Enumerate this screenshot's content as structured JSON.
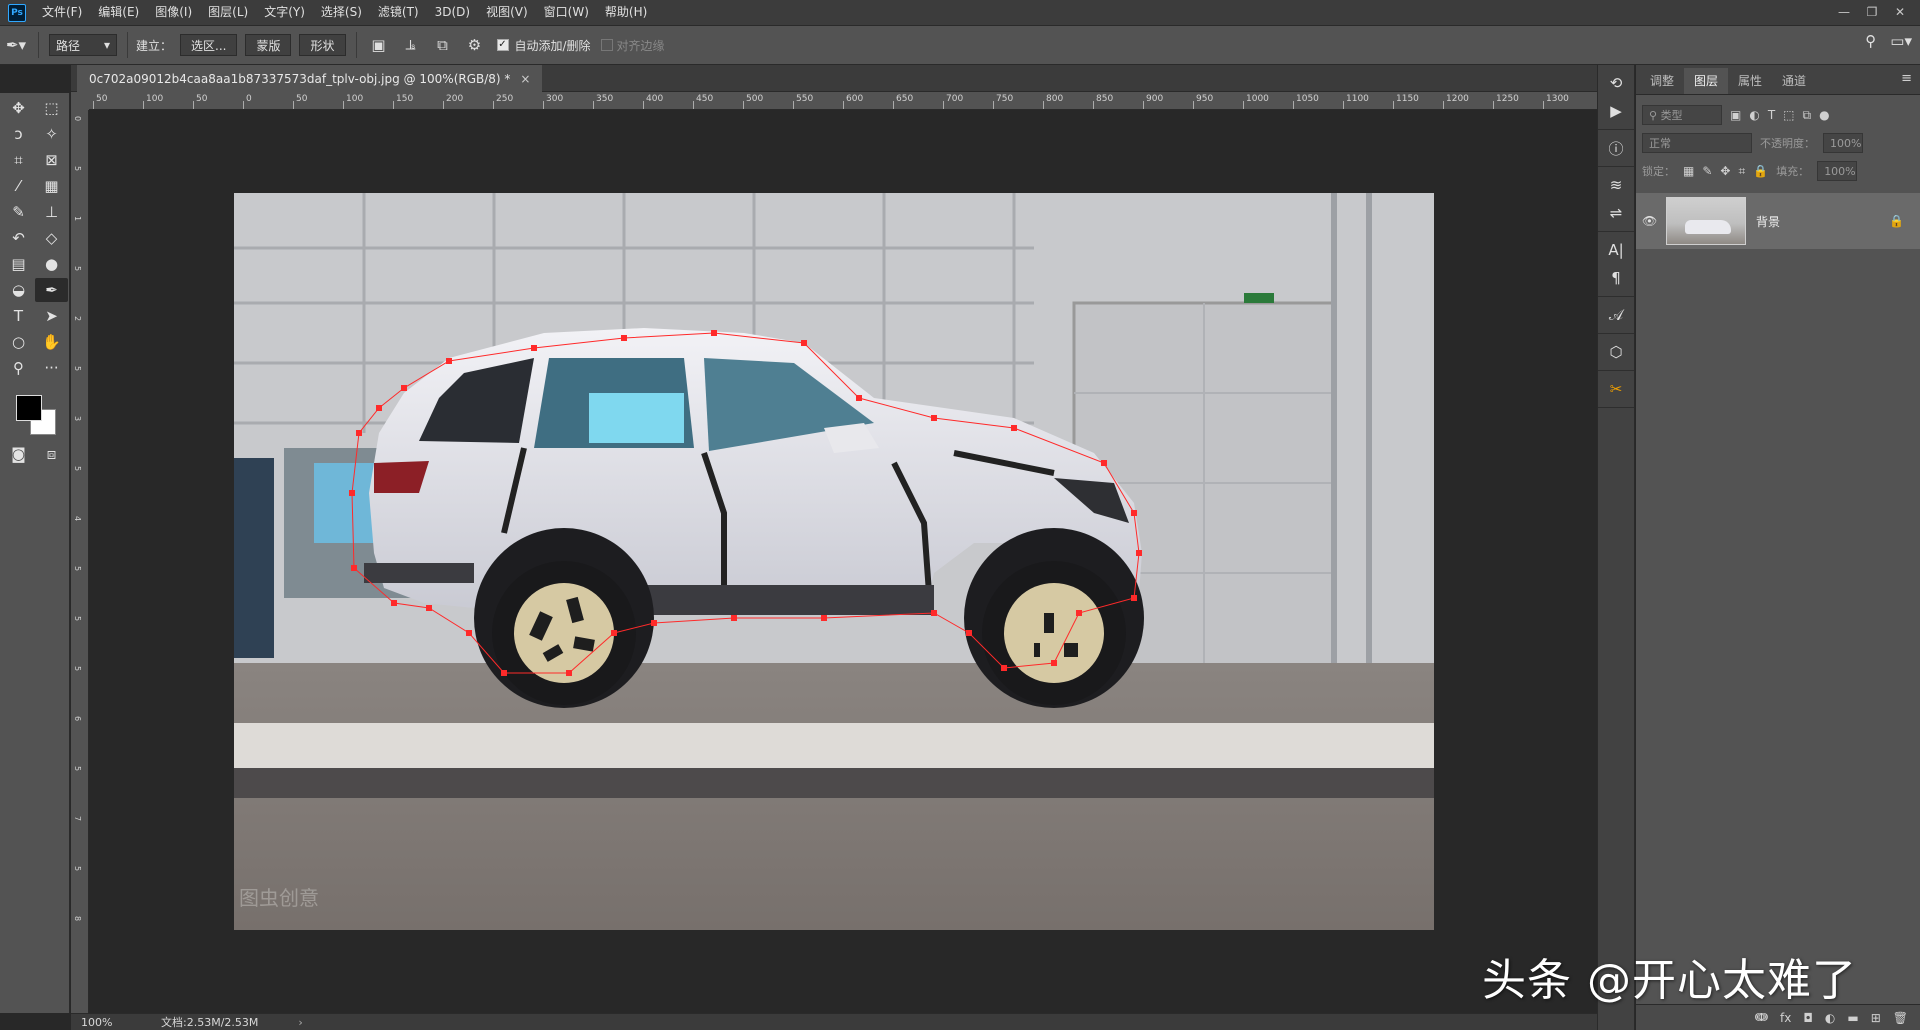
{
  "app": {
    "logo": "Ps"
  },
  "menu": [
    "文件(F)",
    "编辑(E)",
    "图像(I)",
    "图层(L)",
    "文字(Y)",
    "选择(S)",
    "滤镜(T)",
    "3D(D)",
    "视图(V)",
    "窗口(W)",
    "帮助(H)"
  ],
  "window_controls": [
    "—",
    "❐",
    "✕"
  ],
  "options": {
    "mode_select": "路径",
    "build_label": "建立：",
    "selection_btn": "选区...",
    "mask_btn": "蒙版",
    "shape_btn": "形状",
    "auto_add_delete": "自动添加/删除",
    "align_edges": "对齐边缘"
  },
  "document": {
    "tab_title": "0c702a09012b4caa8aa1b87337573daf_tplv-obj.jpg @ 100%(RGB/8) *",
    "close": "×"
  },
  "ruler": {
    "h_labels": [
      "50",
      "100",
      "50",
      "0",
      "50",
      "100",
      "150",
      "200",
      "250",
      "300",
      "350",
      "400",
      "450",
      "500",
      "550",
      "600",
      "650",
      "700",
      "750",
      "800",
      "850",
      "900",
      "950",
      "1000",
      "1050",
      "1100",
      "1150",
      "1200",
      "1250",
      "1300"
    ],
    "v_labels": [
      "0",
      "5",
      "1",
      "5",
      "2",
      "5",
      "3",
      "5",
      "4",
      "5",
      "5",
      "5",
      "6",
      "5",
      "7",
      "5",
      "8"
    ]
  },
  "status": {
    "zoom": "100%",
    "doc_info": "文档:2.53M/2.53M",
    "arrow": "›"
  },
  "panel": {
    "tabs": [
      "调整",
      "图层",
      "属性",
      "通道"
    ],
    "active_tab": "图层",
    "kind_filter": "类型",
    "blend_mode": "正常",
    "opacity_label": "不透明度：",
    "opacity_value": "100%",
    "lock_label": "锁定：",
    "fill_label": "填充：",
    "fill_value": "100%",
    "layers": [
      {
        "name": "背景",
        "visible": true,
        "locked": true
      }
    ],
    "bottom_icons": [
      "ↈ",
      "fx",
      "◘",
      "◐",
      "▬",
      "⊞",
      "🗑"
    ]
  },
  "photo": {
    "watermark": "图虫创意"
  },
  "overlay_watermark": "头条 @开心太难了",
  "colors": {
    "accent": "#31a8ff",
    "path_point": "#ff2a2a",
    "fg": "#000000",
    "bg": "#ffffff"
  }
}
